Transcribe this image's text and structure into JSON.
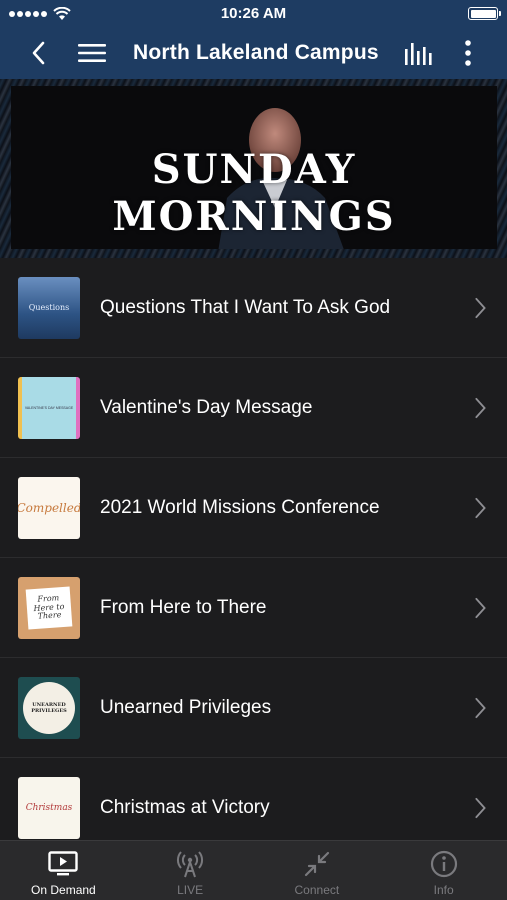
{
  "status_bar": {
    "time": "10:26 AM",
    "signal_icon": "signal-dots-icon",
    "wifi_icon": "wifi-icon",
    "battery_icon": "battery-icon",
    "battery_level": 1.0
  },
  "nav": {
    "title": "North Lakeland Campus",
    "back_icon": "chevron-left-icon",
    "menu_icon": "hamburger-menu-icon",
    "audio_icon": "audio-bars-icon",
    "more_icon": "more-vertical-icon",
    "background_color": "#1e3c62"
  },
  "banner": {
    "title": "SUNDAY MORNINGS"
  },
  "series": [
    {
      "title": "Questions That I Want To Ask God",
      "thumb_text": "Questions",
      "thumb_class": "t1"
    },
    {
      "title": "Valentine's Day Message",
      "thumb_text": "VALENTINE'S DAY MESSAGE",
      "thumb_class": "t2"
    },
    {
      "title": "2021 World Missions Conference",
      "thumb_text": "Compelled",
      "thumb_class": "t3"
    },
    {
      "title": "From Here to There",
      "thumb_text": "From Here to There",
      "thumb_class": "t4"
    },
    {
      "title": "Unearned Privileges",
      "thumb_text": "UNEARNED PRIVILEGES",
      "thumb_class": "t5"
    },
    {
      "title": "Christmas at Victory",
      "thumb_text": "Christmas",
      "thumb_class": "t6"
    }
  ],
  "tabs": [
    {
      "label": "On Demand",
      "icon": "tv-play-icon",
      "active": true
    },
    {
      "label": "LIVE",
      "icon": "broadcast-antenna-icon",
      "active": false
    },
    {
      "label": "Connect",
      "icon": "connect-arrows-icon",
      "active": false
    },
    {
      "label": "Info",
      "icon": "info-circle-icon",
      "active": false
    }
  ],
  "colors": {
    "header": "#1e3c62",
    "list_background": "#1c1c1e",
    "tab_bar": "#2a2a2c",
    "active_tab": "#ffffff",
    "inactive_tab": "#7a7a7e"
  }
}
